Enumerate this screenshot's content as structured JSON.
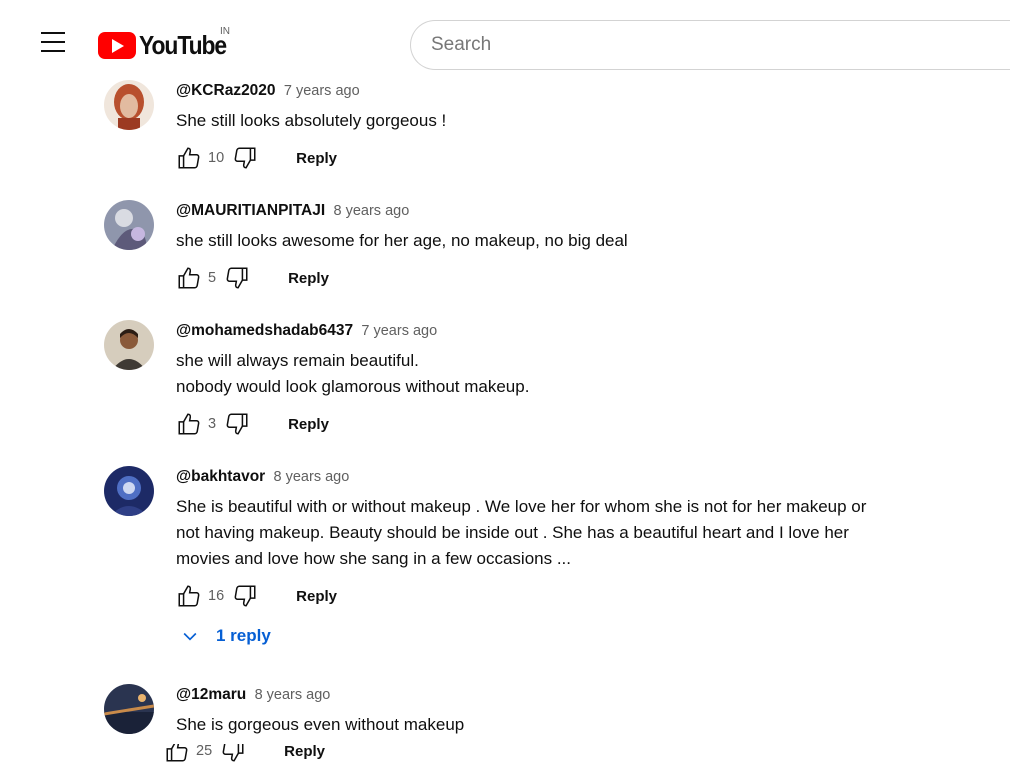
{
  "header": {
    "logo_text": "YouTube",
    "country_code": "IN",
    "search_placeholder": "Search"
  },
  "comments": [
    {
      "handle": "@KCRaz2020",
      "time": "7 years ago",
      "lines": [
        "She still looks absolutely gorgeous !"
      ],
      "likes": "10",
      "reply_label": "Reply",
      "avatar_colors": [
        "#e9d6c8",
        "#b24a2a"
      ]
    },
    {
      "handle": "@MAURITIANPITAJI",
      "time": "8 years ago",
      "lines": [
        "she still looks awesome for her age, no makeup, no big deal"
      ],
      "likes": "5",
      "reply_label": "Reply",
      "avatar_colors": [
        "#a8b2c6",
        "#5a5570"
      ]
    },
    {
      "handle": "@mohamedshadab6437",
      "time": "7 years ago",
      "lines": [
        "she will always remain beautiful.",
        "nobody would look glamorous without makeup."
      ],
      "likes": "3",
      "reply_label": "Reply",
      "avatar_colors": [
        "#c9bfae",
        "#6b4a2f"
      ]
    },
    {
      "handle": "@bakhtavor",
      "time": "8 years ago",
      "lines": [
        "She is beautiful with or without makeup . We love her for whom she is not for her makeup or",
        "not having makeup. Beauty should be inside out . She has a beautiful heart and I love her",
        "movies and love how she sang in a few occasions ..."
      ],
      "likes": "16",
      "reply_label": "Reply",
      "replies_label": "1 reply",
      "avatar_colors": [
        "#1e2c6b",
        "#5b7bc9"
      ]
    },
    {
      "handle": "@12maru",
      "time": "8 years ago",
      "lines": [
        "She is gorgeous even without makeup"
      ],
      "likes": "25",
      "reply_label": "Reply",
      "avatar_colors": [
        "#2a3550",
        "#c8884a"
      ]
    }
  ]
}
